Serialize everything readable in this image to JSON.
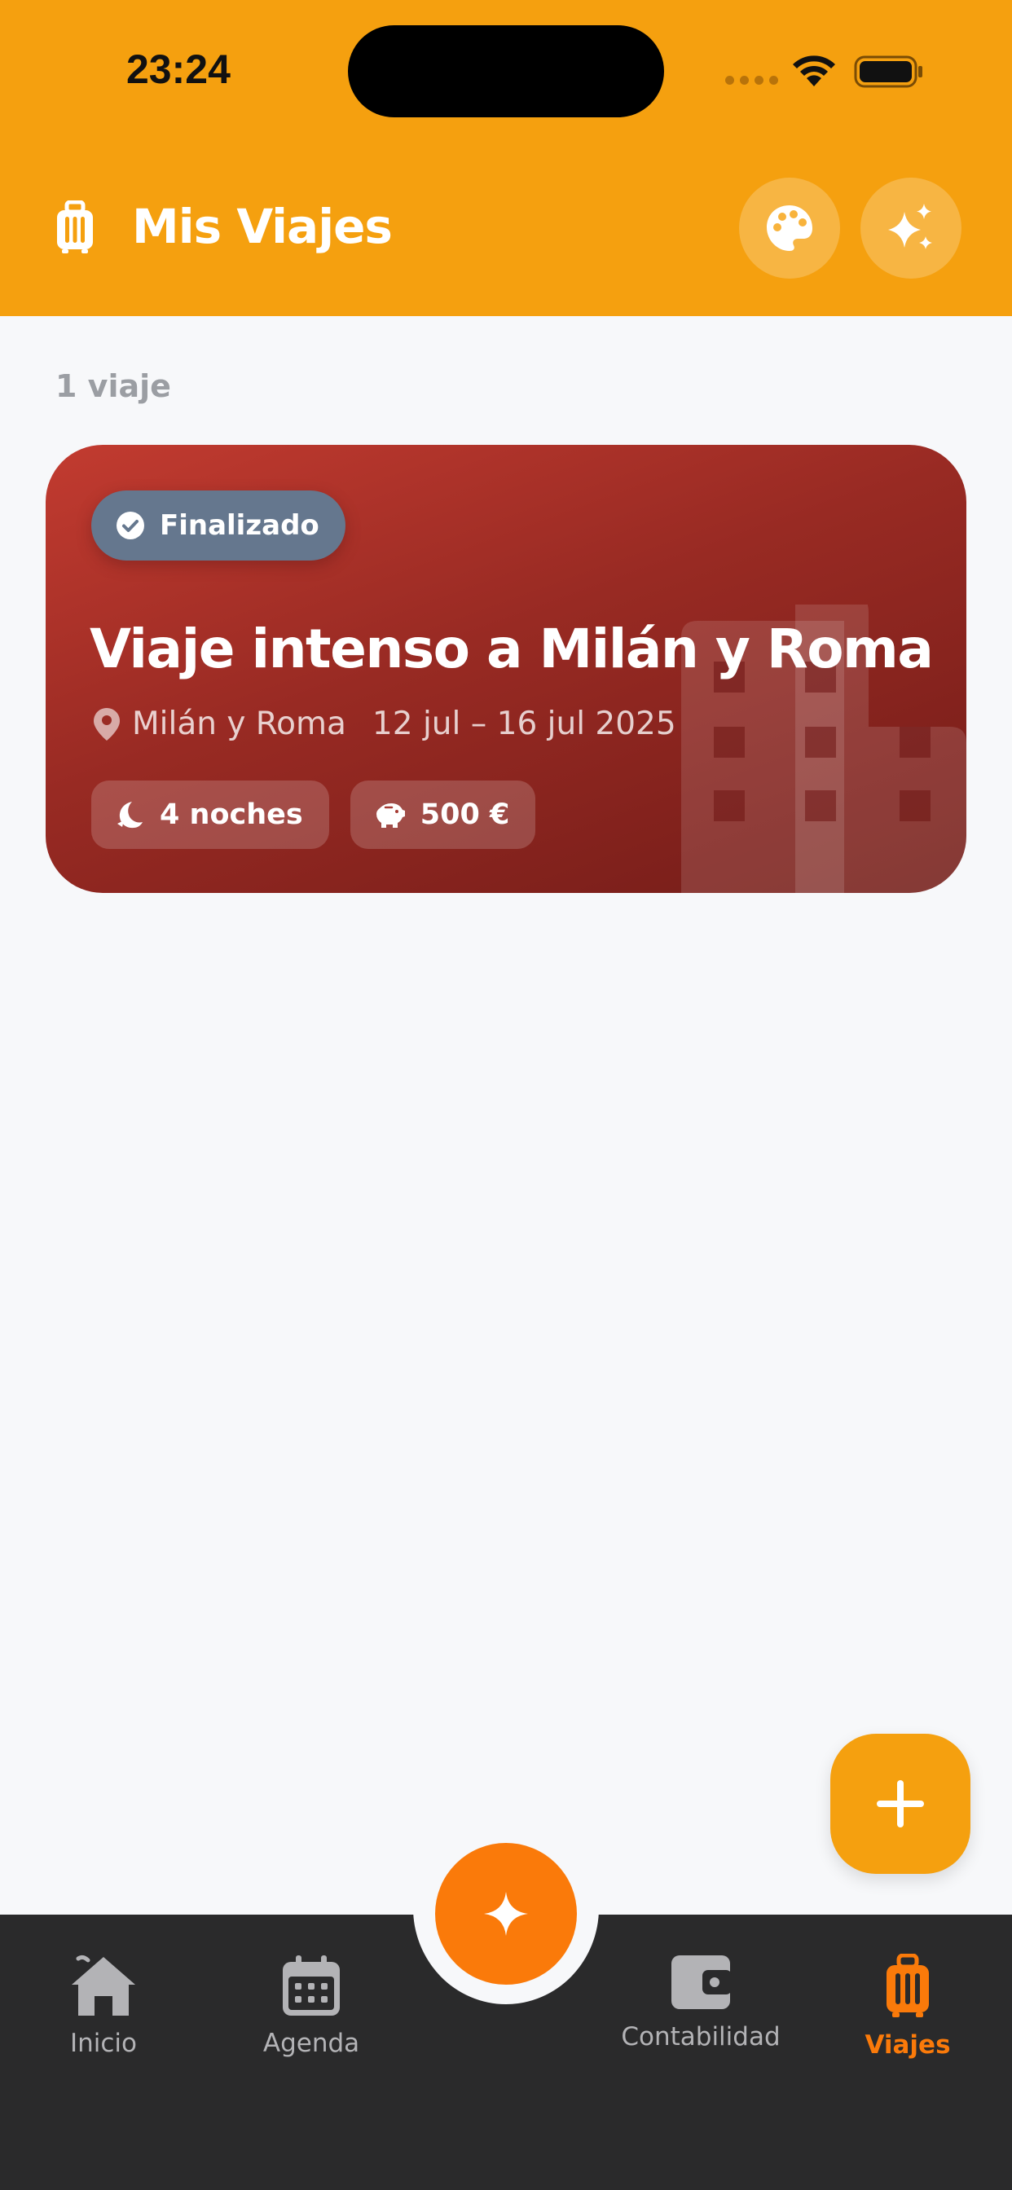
{
  "status_bar": {
    "time": "23:24"
  },
  "header": {
    "title": "Mis Viajes",
    "title_icon": "luggage-icon",
    "buttons": [
      {
        "name": "palette-button",
        "icon": "palette-icon"
      },
      {
        "name": "magic-button",
        "icon": "sparkles-icon"
      }
    ],
    "background_color": "#f5a00f"
  },
  "content": {
    "count_label": "1 viaje",
    "trips": [
      {
        "status": "Finalizado",
        "status_icon": "check-circle-icon",
        "title": "Viaje intenso a Milán y Roma",
        "location": "Milán y Roma",
        "dates": "12 jul – 16 jul 2025",
        "nights": "4 noches",
        "nights_icon": "moon-icon",
        "budget": "500 €",
        "budget_icon": "piggy-bank-icon",
        "background_icon": "city-buildings-icon",
        "colors": {
          "start": "#c23b30",
          "end": "#731c18",
          "status_pill": "#65778e"
        }
      }
    ]
  },
  "fab": {
    "icon": "plus-icon",
    "color": "#f5a00f"
  },
  "bottom_nav": {
    "center_icon": "sparkle-icon",
    "center_color": "#fa7a0a",
    "items": [
      {
        "label": "Inicio",
        "icon": "home-icon",
        "active": false
      },
      {
        "label": "Agenda",
        "icon": "calendar-icon",
        "active": false
      },
      {
        "label": "Contabilidad",
        "icon": "wallet-icon",
        "active": false
      },
      {
        "label": "Viajes",
        "icon": "luggage-icon",
        "active": true
      }
    ],
    "active_color": "#fa7a0a"
  }
}
